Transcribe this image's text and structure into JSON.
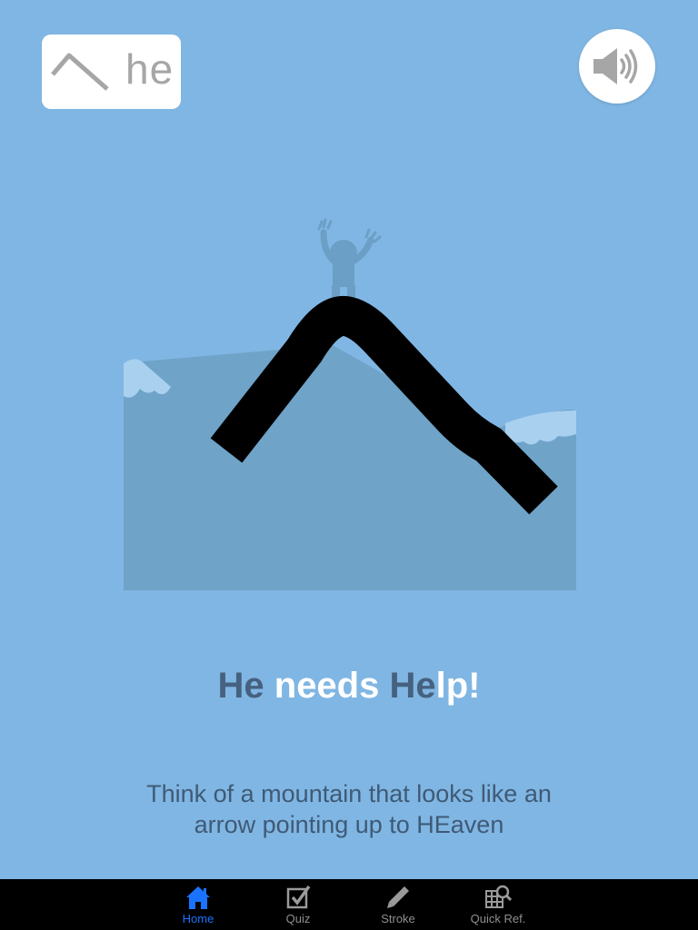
{
  "kana_card": {
    "character_icon": "hiragana-he-glyph",
    "romaji": "he"
  },
  "sound_button": {
    "icon": "speaker-icon"
  },
  "mnemonic": {
    "title_parts": [
      "He",
      " needs ",
      "He",
      "lp!"
    ],
    "text_lines": [
      "Think of a mountain that looks like an",
      "arrow pointing up to HEaven"
    ]
  },
  "tab_bar": {
    "tabs": [
      {
        "label": "Home",
        "icon": "home-icon",
        "active": true
      },
      {
        "label": "Quiz",
        "icon": "checkbox-icon",
        "active": false
      },
      {
        "label": "Stroke",
        "icon": "pencil-icon",
        "active": false
      },
      {
        "label": "Quick Ref.",
        "icon": "grid-search-icon",
        "active": false
      }
    ]
  },
  "colors": {
    "background": "#80b6e3",
    "mountain": "#6fa3c8",
    "snow": "#a9d0ef",
    "stroke": "#000000",
    "figure": "#6b9fc6",
    "highlight_text": "#46617f",
    "active_tab": "#1a73ff",
    "inactive_tab": "#8f8f8f"
  }
}
